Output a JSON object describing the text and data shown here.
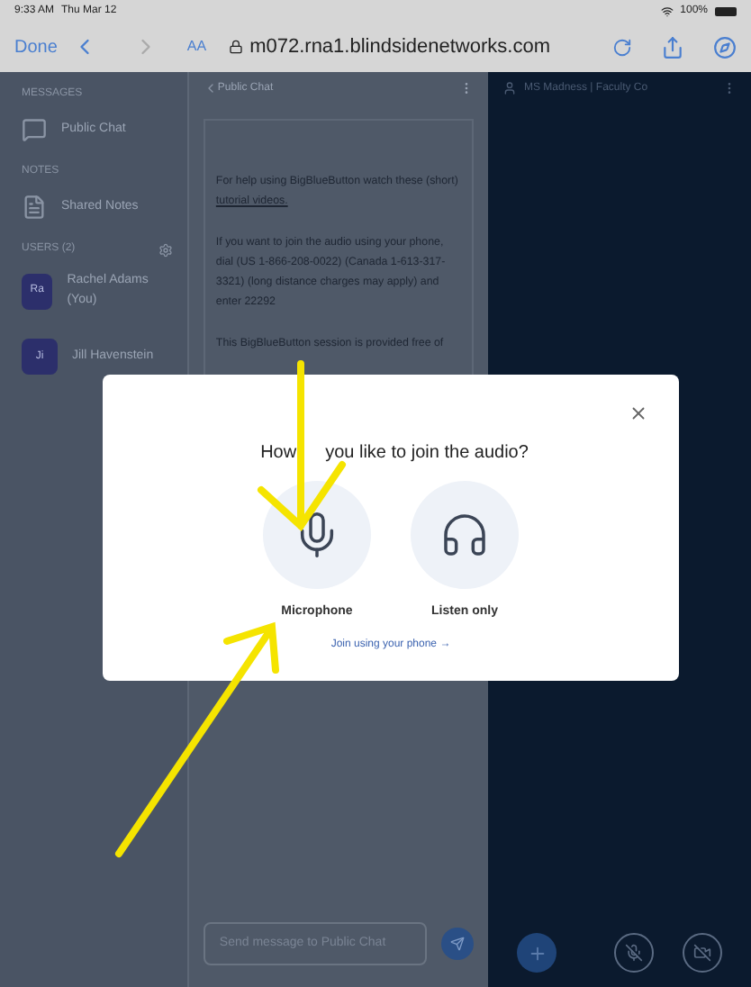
{
  "status_bar": {
    "time": "9:33 AM",
    "date": "Thu Mar 12",
    "battery": "100%"
  },
  "browser": {
    "done": "Done",
    "text_size": "AA",
    "url": "m072.rna1.blindsidenetworks.com"
  },
  "sidebar": {
    "sections": [
      {
        "heading": "MESSAGES",
        "items": [
          {
            "kind": "chat",
            "label": "Public Chat"
          }
        ]
      },
      {
        "heading": "NOTES",
        "items": [
          {
            "kind": "notes",
            "label": "Shared Notes"
          }
        ]
      },
      {
        "heading": "USERS (2)",
        "settings": true,
        "items": [
          {
            "kind": "user",
            "initials": "Ra",
            "label": "Rachel Adams (You)"
          },
          {
            "kind": "user",
            "initials": "Ji",
            "label": "Jill Havenstein"
          }
        ]
      }
    ]
  },
  "chat": {
    "title": "Public Chat",
    "paragraphs": [
      {
        "text": "For help using BigBlueButton watch these (short) ",
        "link": "tutorial videos."
      },
      {
        "text": "If you want to join the audio using your phone, dial (US 1-866-208-0022) (Canada 1-613-317-3321) (long distance charges may apply) and enter 22292"
      },
      {
        "text": "This BigBlueButton session is provided free of"
      }
    ],
    "placeholder": "Send message to Public Chat"
  },
  "presentation": {
    "title": "MS Madness | Faculty Co"
  },
  "modal": {
    "question": [
      "How",
      "you like to join the audio?"
    ],
    "options": [
      {
        "kind": "microphone",
        "label": "Microphone"
      },
      {
        "kind": "listen",
        "label": "Listen only"
      }
    ],
    "phone_link": "Join using your phone →"
  }
}
